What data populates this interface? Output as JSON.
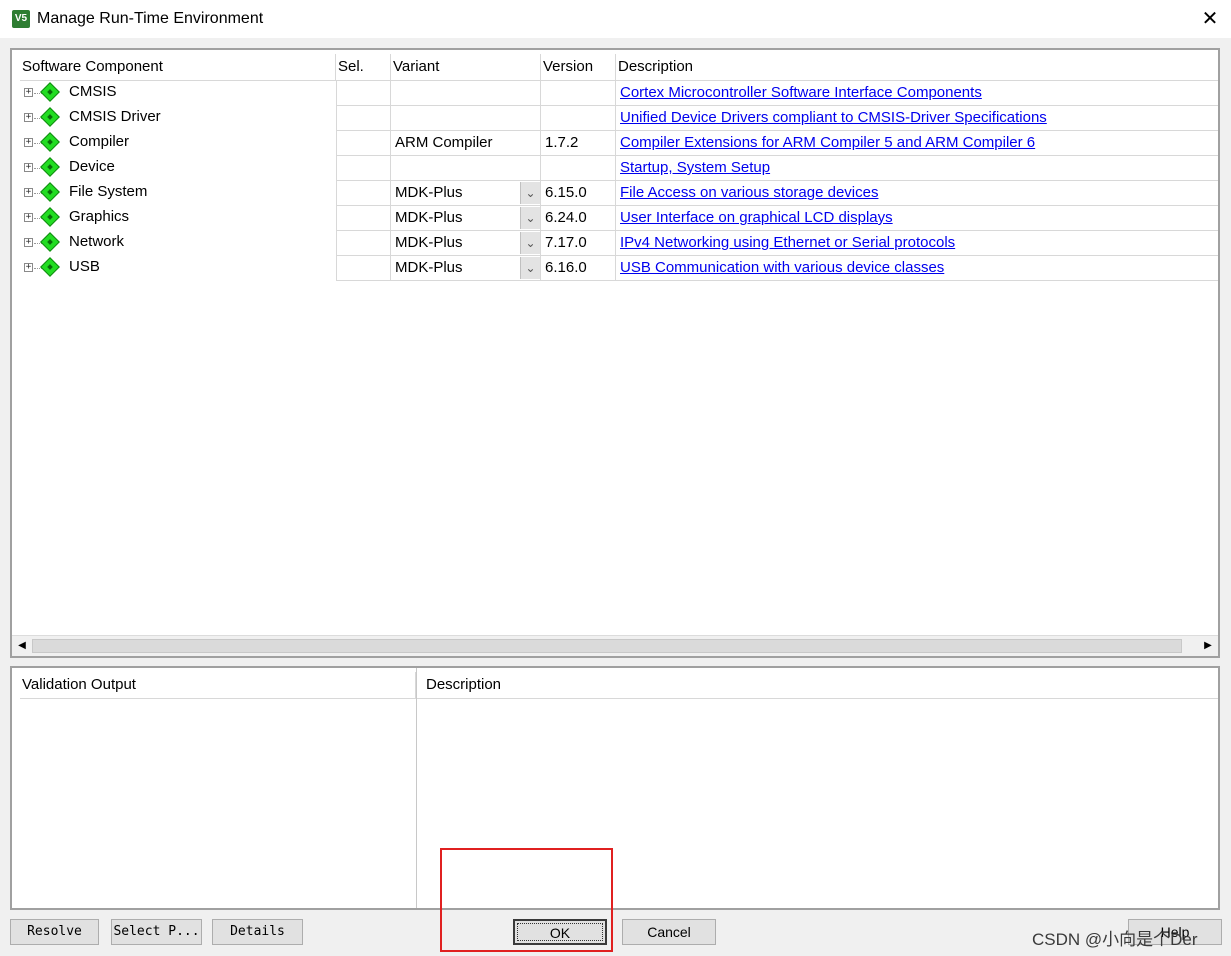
{
  "window": {
    "title": "Manage Run-Time Environment",
    "icon_text": "V5"
  },
  "grid": {
    "columns": [
      "Software Component",
      "Sel.",
      "Variant",
      "Version",
      "Description"
    ],
    "rows": [
      {
        "name": "CMSIS",
        "variant": "",
        "has_dropdown": false,
        "version": "",
        "description": "Cortex Microcontroller Software Interface Components"
      },
      {
        "name": "CMSIS Driver",
        "variant": "",
        "has_dropdown": false,
        "version": "",
        "description": "Unified Device Drivers compliant to CMSIS-Driver Specifications"
      },
      {
        "name": "Compiler",
        "variant": "ARM Compiler",
        "has_dropdown": false,
        "version": "1.7.2",
        "description": "Compiler Extensions for ARM Compiler 5 and ARM Compiler 6"
      },
      {
        "name": "Device",
        "variant": "",
        "has_dropdown": false,
        "version": "",
        "description": "Startup, System Setup"
      },
      {
        "name": "File System",
        "variant": "MDK-Plus",
        "has_dropdown": true,
        "version": "6.15.0",
        "description": "File Access on various storage devices"
      },
      {
        "name": "Graphics",
        "variant": "MDK-Plus",
        "has_dropdown": true,
        "version": "6.24.0",
        "description": "User Interface on graphical LCD displays"
      },
      {
        "name": "Network",
        "variant": "MDK-Plus",
        "has_dropdown": true,
        "version": "7.17.0",
        "description": "IPv4 Networking using Ethernet or Serial protocols"
      },
      {
        "name": "USB",
        "variant": "MDK-Plus",
        "has_dropdown": true,
        "version": "6.16.0",
        "description": "USB Communication with various device classes"
      }
    ]
  },
  "validation": {
    "columns": [
      "Validation Output",
      "Description"
    ]
  },
  "buttons": {
    "resolve": "Resolve",
    "select_packs": "Select P...",
    "details": "Details",
    "ok": "OK",
    "cancel": "Cancel",
    "help": "Help"
  },
  "watermark": "CSDN @小向是个Der",
  "colors": {
    "gem": "#22dd22",
    "link": "#0000ee",
    "highlight": "#e02020"
  }
}
